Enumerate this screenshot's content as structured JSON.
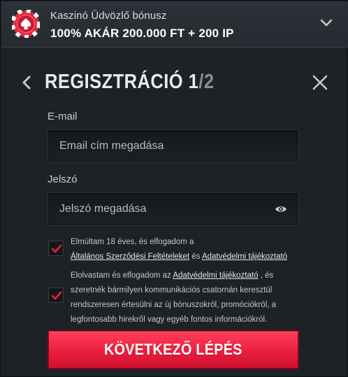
{
  "promo": {
    "subtitle": "Kaszinó Üdvözlő bónusz",
    "headline": "100% AKÁR 200.000 FT + 200 IP",
    "icon": "poker-chip-icon",
    "toggle_icon": "chevron-down-icon"
  },
  "header": {
    "title": "REGISZTRÁCIÓ",
    "step": "1",
    "total": "/2",
    "back_icon": "chevron-left-icon",
    "close_icon": "close-icon"
  },
  "form": {
    "email_label": "E-mail",
    "email_placeholder": "Email cím megadása",
    "email_value": "",
    "password_label": "Jelszó",
    "password_placeholder": "Jelszó megadása",
    "password_value": "",
    "password_toggle_icon": "eye-icon"
  },
  "consents": [
    {
      "checked": true,
      "text_1": "Elmúltam 18 éves, és elfogadom a",
      "link_1": "Általános Szerződési Feltételeket",
      "text_2": " és ",
      "link_2": "Adatvédelmi tájékoztató"
    },
    {
      "checked": true,
      "text_1": "Elolvastam és elfogadom az ",
      "link_1": "Adatvédelmi tájékoztató",
      "text_2": " , és szeretnék bármilyen kommunikációs csatornán keresztül rendszeresen értesülni az új bónuszokról, promóciókról, a legfontosabb hirekről vagy egyéb fontos információkról."
    }
  ],
  "submit_label": "KÖVETKEZŐ LÉPÉS",
  "colors": {
    "accent": "#e91f3e",
    "background": "#1e2227",
    "banner": "#2a2f35"
  }
}
